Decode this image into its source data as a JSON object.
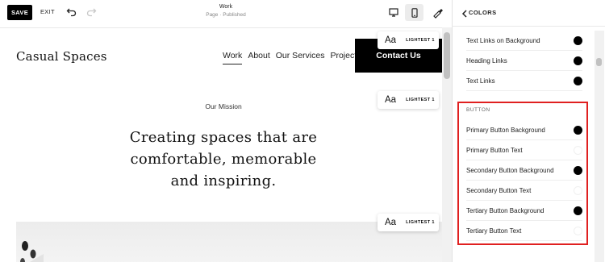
{
  "toolbar": {
    "save_label": "SAVE",
    "exit_label": "EXIT",
    "page_title": "Work",
    "page_status": "Page · Published"
  },
  "site": {
    "logo": "Casual Spaces",
    "nav": [
      "Work",
      "About",
      "Our Services",
      "Projects"
    ],
    "contact_label": "Contact Us",
    "mission_label": "Our Mission",
    "headline_lines": [
      "Creating spaces that are",
      "comfortable, memorable",
      "and inspiring."
    ]
  },
  "section_badges": [
    {
      "aa": "Aa",
      "tag": "LIGHTEST 1"
    },
    {
      "aa": "Aa",
      "tag": "LIGHTEST 1"
    },
    {
      "aa": "Aa",
      "tag": "LIGHTEST 1"
    }
  ],
  "panel": {
    "title": "COLORS",
    "link_rows": [
      {
        "label": "Text Links on Background",
        "color": "#000000"
      },
      {
        "label": "Heading Links",
        "color": "#000000"
      },
      {
        "label": "Text Links",
        "color": "#000000"
      }
    ],
    "button_group_label": "BUTTON",
    "button_rows": [
      {
        "label": "Primary Button Background",
        "color": "#000000"
      },
      {
        "label": "Primary Button Text",
        "color": "#ffffff"
      },
      {
        "label": "Secondary Button Background",
        "color": "#000000"
      },
      {
        "label": "Secondary Button Text",
        "color": "#ffffff"
      },
      {
        "label": "Tertiary Button Background",
        "color": "#000000"
      },
      {
        "label": "Tertiary Button Text",
        "color": "#ffffff"
      }
    ]
  },
  "colors": {
    "highlight_border": "#e02020",
    "accent": "#000000"
  }
}
